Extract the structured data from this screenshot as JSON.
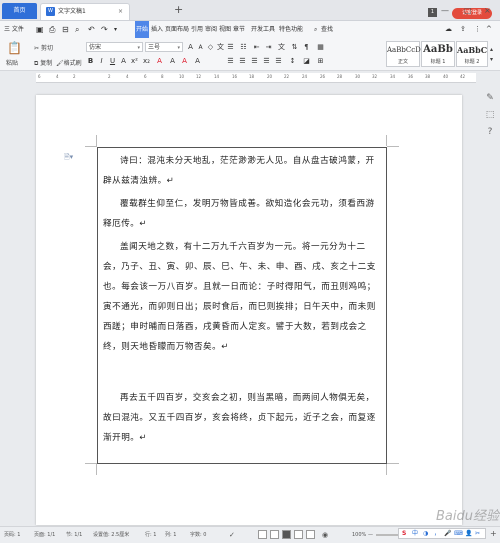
{
  "titlebar": {
    "home_tab": "首页",
    "doc_tab_icon": "W",
    "doc_tab": "文字文稿1",
    "doc_tab_close": "×",
    "add_tab": "+",
    "badge": "1",
    "login": "访客登录",
    "win_min": "—",
    "win_max": "□",
    "win_close": "×"
  },
  "menubar": {
    "file": "三 文件",
    "items": [
      "开始",
      "插入",
      "页面布局",
      "引用",
      "审阅",
      "视图",
      "章节",
      "开发工具",
      "特色功能"
    ],
    "search": "查找"
  },
  "ribbon": {
    "paste": "粘贴",
    "cut": "剪切",
    "copy": "复制",
    "format_painter": "格式刷",
    "font": "仿宋",
    "size": "三号",
    "styles": [
      {
        "preview": "AaBbCcDd",
        "name": "正文"
      },
      {
        "preview": "AaBb",
        "name": "标题 1"
      },
      {
        "preview": "AaBbC",
        "name": "标题 2"
      }
    ],
    "new_style": "新样式"
  },
  "ruler": {
    "numbers": [
      "6",
      "4",
      "2",
      "",
      "2",
      "4",
      "6",
      "8",
      "10",
      "12",
      "14",
      "16",
      "18",
      "20",
      "22",
      "24",
      "26",
      "28",
      "30",
      "32",
      "34",
      "36",
      "38",
      "40",
      "42"
    ]
  },
  "document": {
    "paragraphs": [
      "诗曰：混沌未分天地乱，茫茫渺渺无人见。自从盘古破鸿蒙，开辟从兹清浊辨。↵",
      "覆载群生仰至仁，发明万物皆成善。欲知造化会元功，须看西游释厄传。↵",
      "盖闻天地之数，有十二万九千六百岁为一元。将一元分为十二会，乃子、丑、寅、卯、辰、巳、午、未、申、酉、戌、亥之十二支也。每会该一万八百岁。且就一日而论：子时得阳气，而丑则鸡鸣；寅不通光，而卯则日出；辰时食后，而巳则挨排；日午天中，而未则西蹉；申时晡而日落酉，戌黄昏而人定亥。譬于大数，若到戌会之终，则天地昏矇而万物否矣。↵",
      "再去五千四百岁，交亥会之初，则当黑暗，而两间人物俱无矣，故曰混沌。又五千四百岁，亥会将终，贞下起元，近子之会，而复逐渐开明。↵"
    ]
  },
  "statusbar": {
    "page": "页码: 1",
    "pages": "页面: 1/1",
    "section": "节: 1/1",
    "setting": "设置值: 2.5厘米",
    "row": "行: 1",
    "col": "列: 1",
    "words": "字数: 0",
    "zoom": "100%",
    "zoom_minus": "—",
    "zoom_plus": "+"
  },
  "ime": {
    "items": [
      "S",
      "中",
      "◑",
      "，",
      "🎤",
      "⌨",
      "👤",
      "✂"
    ]
  },
  "watermark": "Baidu经验"
}
